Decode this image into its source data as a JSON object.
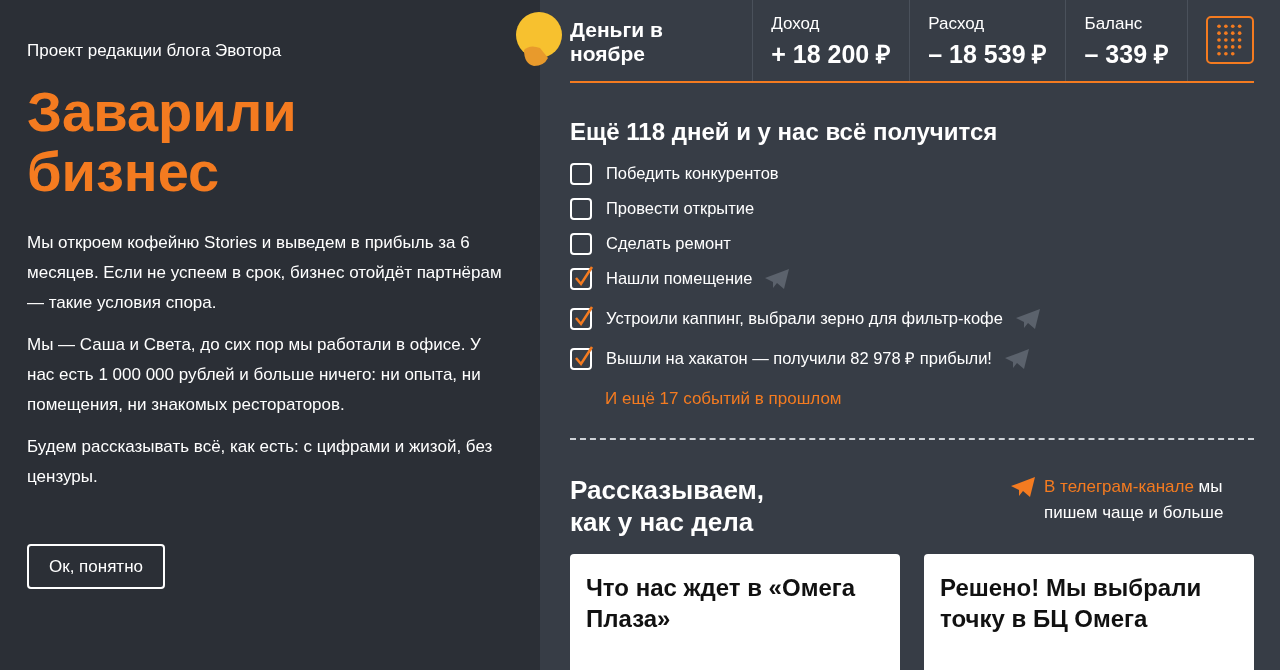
{
  "intro": {
    "kicker": "Проект редакции блога Эвотора",
    "title": "Заварили бизнес",
    "paragraphs": [
      "Мы откроем кофейню Stories и выведем в прибыль за 6 месяцев. Если не успеем в срок, бизнес отойдёт партнёрам — такие условия спора.",
      "Мы — Саша и Света, до сих пор мы работали в офисе. У нас есть 1 000 000 рублей и больше ничего: ни опыта, ни помещения, ни знакомых рестораторов.",
      "Будем рассказывать всё, как есть: с цифрами и жизой, без цензуры."
    ],
    "button": "Ок, понятно"
  },
  "money": {
    "title": "Деньги в ноябре",
    "stats": [
      {
        "label": "Доход",
        "value": "+ 18 200 ₽"
      },
      {
        "label": "Расход",
        "value": "– 18 539 ₽"
      },
      {
        "label": "Баланс",
        "value": "– 339 ₽"
      }
    ]
  },
  "goals": {
    "heading": "Ещё 118 дней и у нас всё получится",
    "items": [
      {
        "text": "Победить конкурентов",
        "checked": false
      },
      {
        "text": "Провести открытие",
        "checked": false
      },
      {
        "text": "Сделать ремонт",
        "checked": false
      },
      {
        "text": "Нашли помещение",
        "checked": true
      },
      {
        "text": "Устроили каппинг, выбрали зерно для фильтр-кофе",
        "checked": true
      },
      {
        "text": "Вышли на хакатон — получили 82 978 ₽ прибыли!",
        "checked": true
      }
    ],
    "more_link": "И ещё 17 событий в прошлом"
  },
  "news": {
    "heading": "Рассказываем, как у нас дела",
    "telegram_link": "В телеграм-канале",
    "telegram_text": "мы пишем чаще и больше",
    "cards": [
      {
        "title": "Что нас ждет в «Омега Плаза»"
      },
      {
        "title": "Решено! Мы выбрали точку в БЦ Омега"
      }
    ]
  }
}
